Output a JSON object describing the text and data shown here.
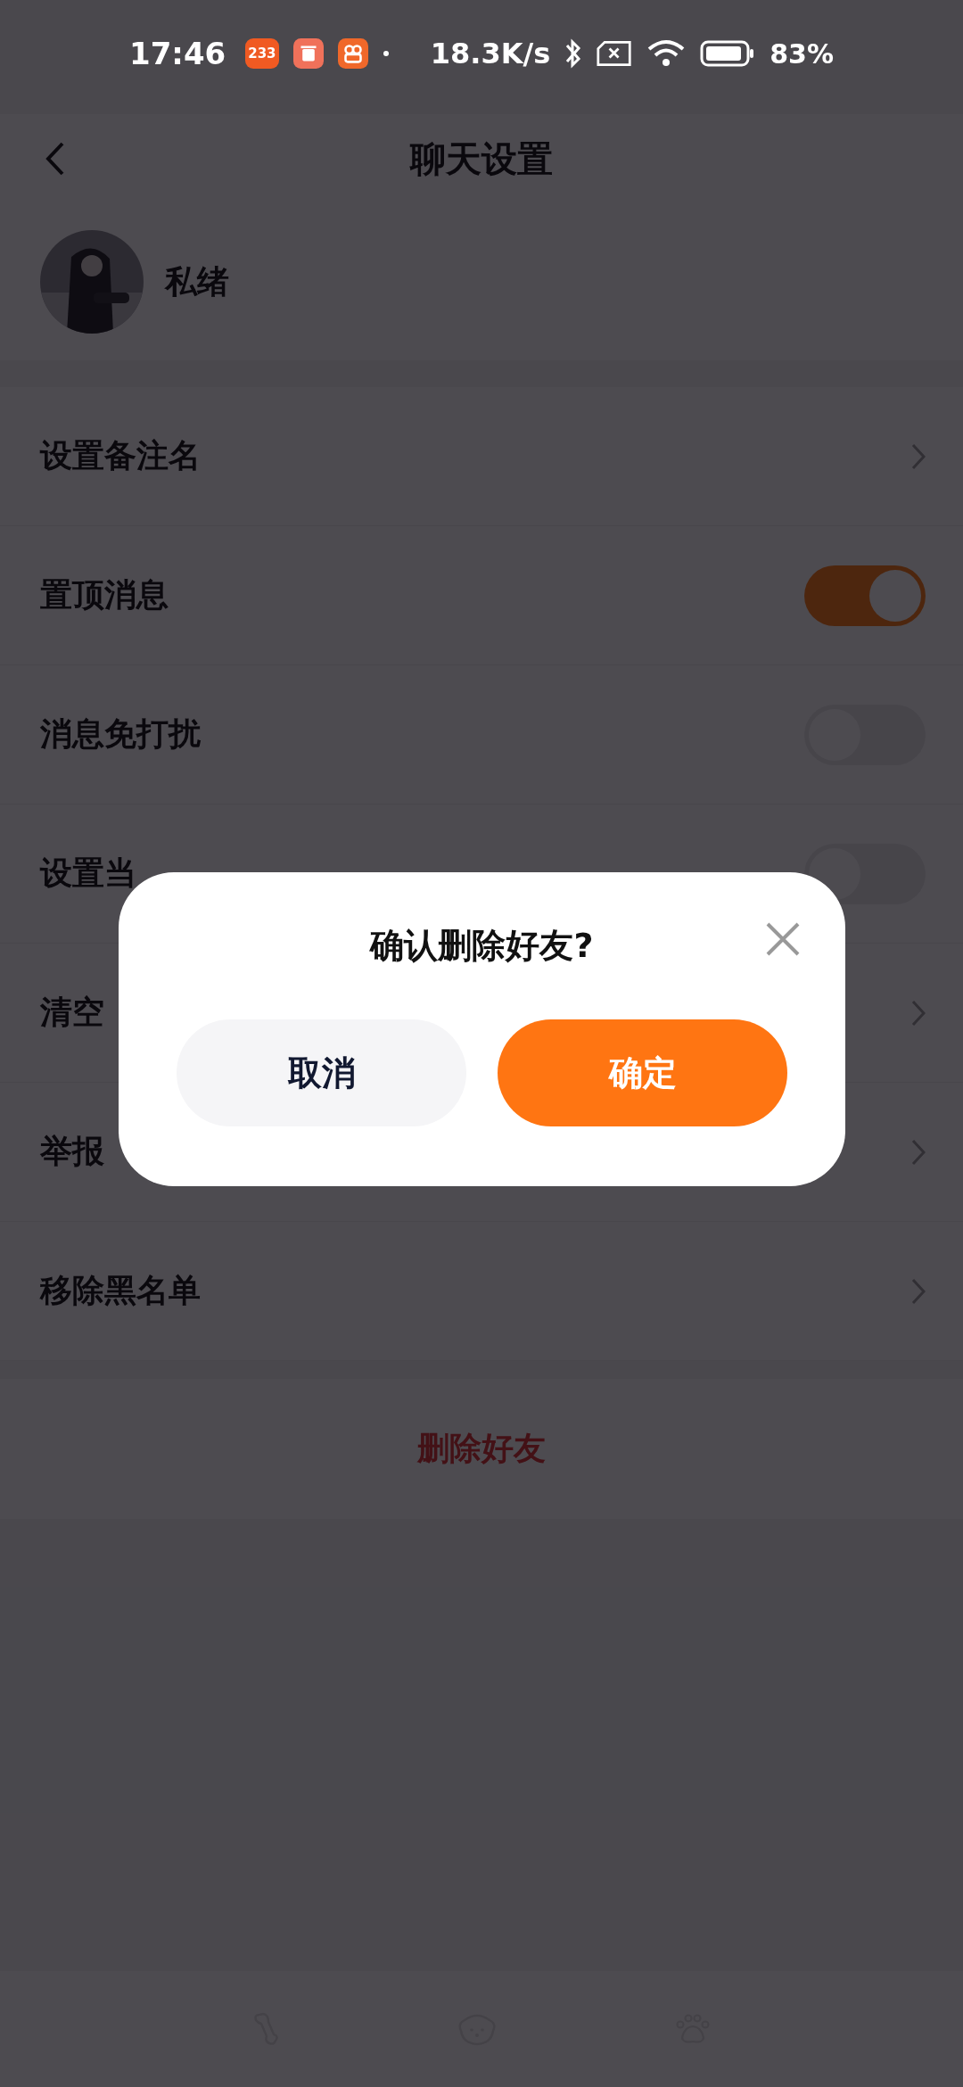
{
  "status_bar": {
    "time": "17:46",
    "notification_icons": [
      {
        "kind": "badge",
        "text": "233"
      },
      {
        "kind": "trash"
      },
      {
        "kind": "video"
      },
      {
        "kind": "dot"
      }
    ],
    "net_speed": "18.3K/s",
    "battery": "83%"
  },
  "header": {
    "title": "聊天设置"
  },
  "profile": {
    "name": "私绪"
  },
  "settings": [
    {
      "label": "设置备注名",
      "kind": "chevron"
    },
    {
      "label": "置顶消息",
      "kind": "toggle",
      "on": true
    },
    {
      "label": "消息免打扰",
      "kind": "toggle",
      "on": false
    },
    {
      "label": "设置当",
      "kind": "toggle",
      "on": false
    },
    {
      "label": "清空",
      "kind": "chevron"
    },
    {
      "label": "举报",
      "kind": "chevron"
    },
    {
      "label": "移除黑名单",
      "kind": "chevron"
    }
  ],
  "delete_button": "删除好友",
  "bottom_nav": [
    {
      "kind": "bone"
    },
    {
      "kind": "dog"
    },
    {
      "kind": "paw"
    }
  ],
  "dialog": {
    "title": "确认删除好友?",
    "cancel": "取消",
    "confirm": "确定"
  }
}
